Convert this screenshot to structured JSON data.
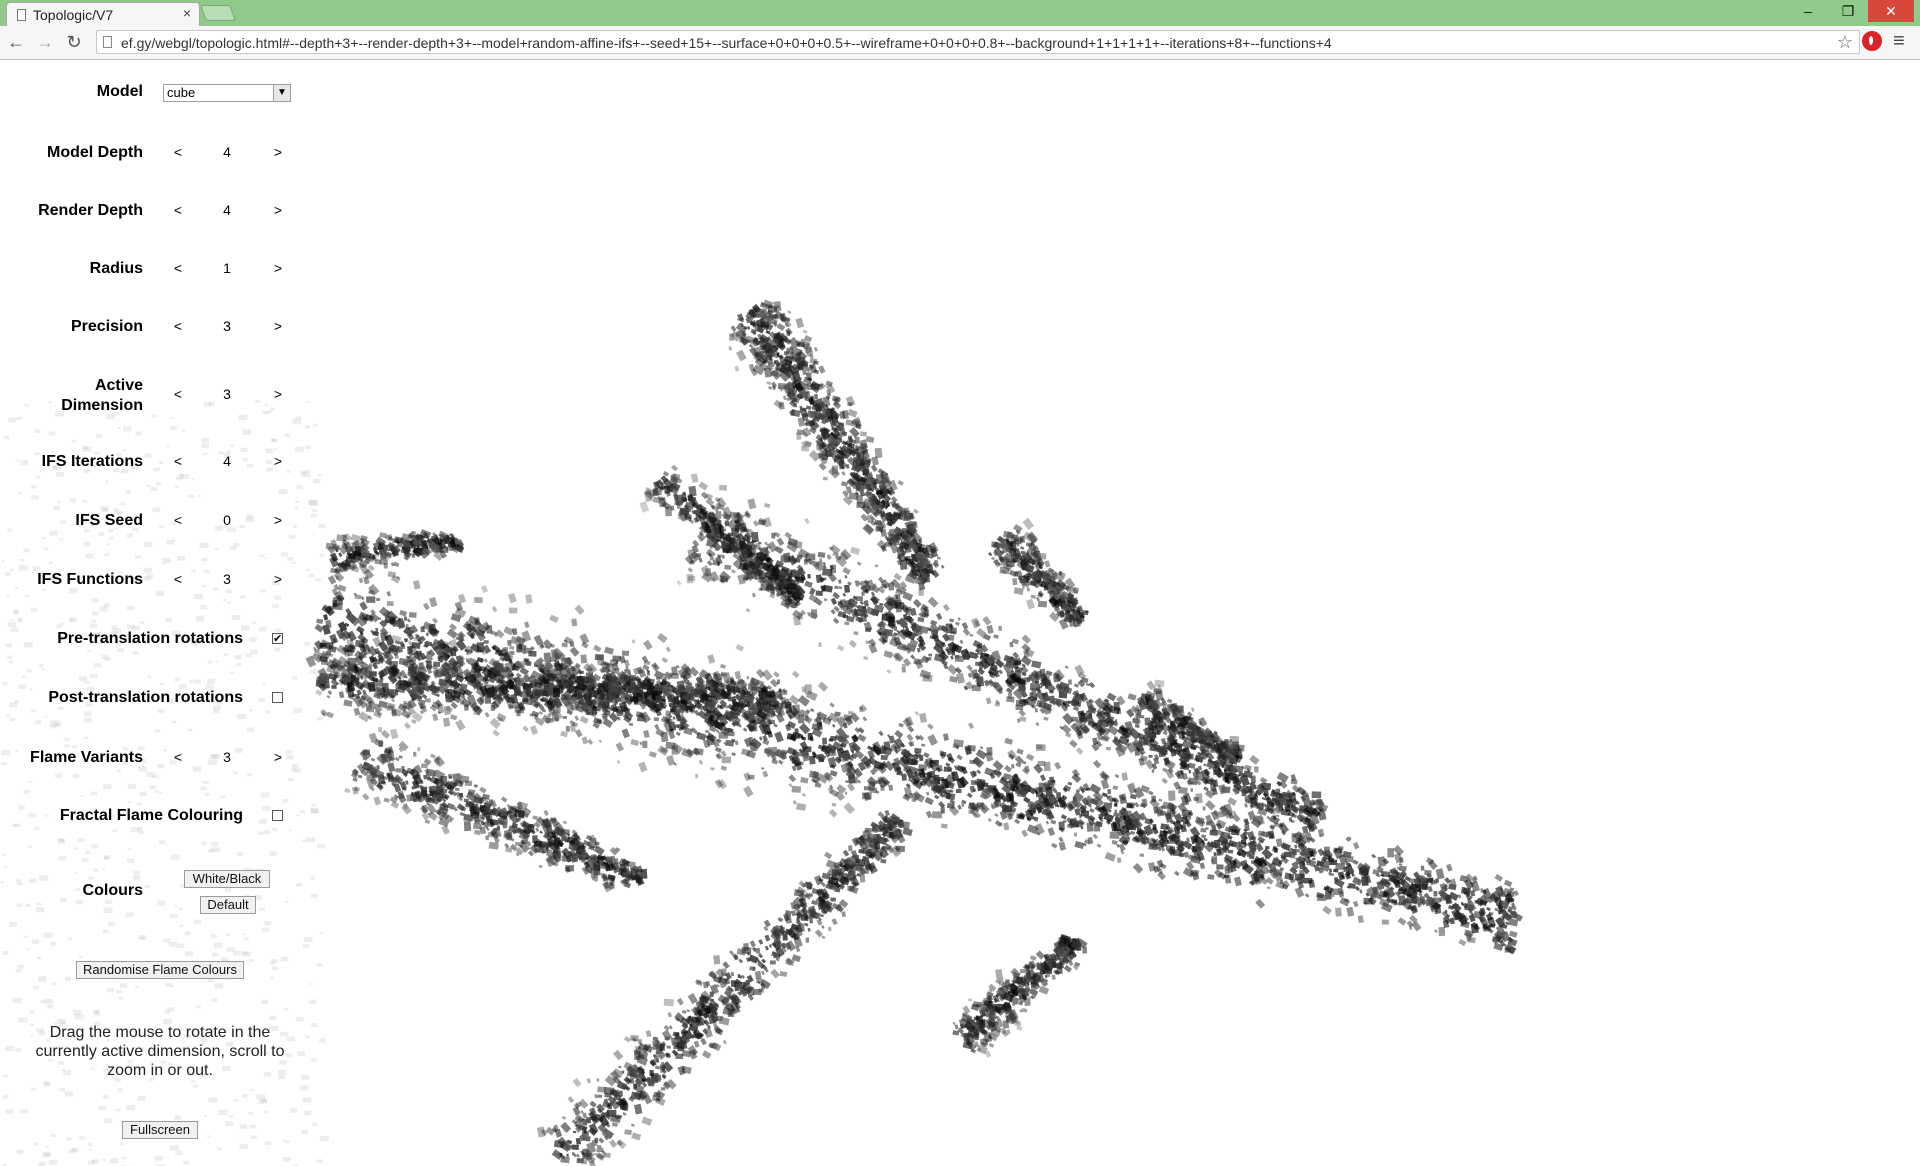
{
  "browser": {
    "tab_title": "Topologic/V7",
    "tab_close": "×",
    "url": "ef.gy/webgl/topologic.html#--depth+3+--render-depth+3+--model+random-affine-ifs+--seed+15+--surface+0+0+0+0.5+--wireframe+0+0+0+0.8+--background+1+1+1+1+--iterations+8+--functions+4",
    "minimize": "–",
    "maximize": "❐",
    "close": "✕"
  },
  "controls": {
    "model": {
      "label": "Model",
      "value": "cube"
    },
    "model_depth": {
      "label": "Model Depth",
      "value": "4"
    },
    "render_depth": {
      "label": "Render Depth",
      "value": "4"
    },
    "radius": {
      "label": "Radius",
      "value": "1"
    },
    "precision": {
      "label": "Precision",
      "value": "3"
    },
    "active_dimension": {
      "label": "Active Dimension",
      "value": "3"
    },
    "ifs_iterations": {
      "label": "IFS Iterations",
      "value": "4"
    },
    "ifs_seed": {
      "label": "IFS Seed",
      "value": "0"
    },
    "ifs_functions": {
      "label": "IFS Functions",
      "value": "3"
    },
    "pre_translation": {
      "label": "Pre-translation rotations",
      "checked": true
    },
    "post_translation": {
      "label": "Post-translation rotations",
      "checked": false
    },
    "flame_variants": {
      "label": "Flame Variants",
      "value": "3"
    },
    "fractal_flame_colouring": {
      "label": "Fractal Flame Colouring",
      "checked": false
    },
    "colours": {
      "label": "Colours",
      "white_black": "White/Black",
      "default": "Default"
    },
    "randomise_button": "Randomise Flame Colours",
    "help": "Drag the mouse to rotate in the currently active dimension, scroll to zoom in or out.",
    "fullscreen_button": "Fullscreen",
    "dec": "<",
    "inc": ">",
    "check_mark": "✔"
  }
}
